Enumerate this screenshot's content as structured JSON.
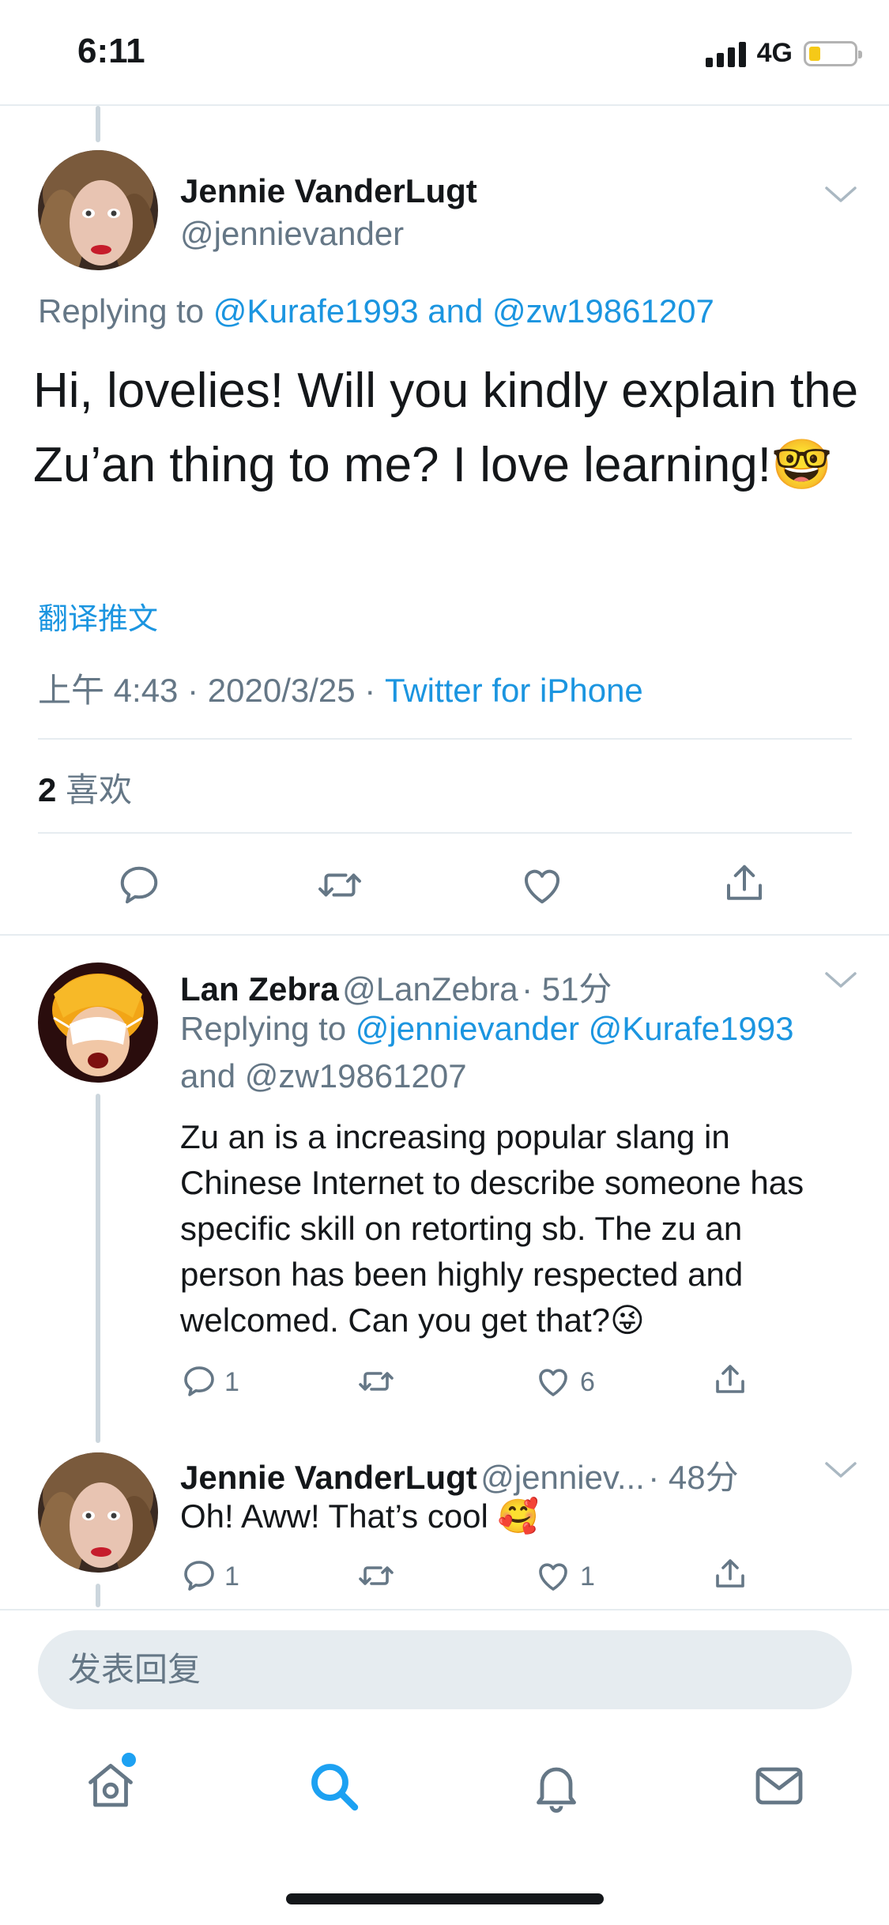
{
  "status_bar": {
    "time": "6:11",
    "network": "4G",
    "battery_level": 0.2
  },
  "main_tweet": {
    "author_name": "Jennie VanderLugt",
    "author_handle": "@jennievander",
    "replying_prefix": "Replying to",
    "replying_users": "@Kurafe1993 and @zw19861207",
    "text": "Hi, lovelies! Will you kindly explain the Zu’an thing to me? I love learning!🤓",
    "translate_label": "翻译推文",
    "time": "上午 4:43",
    "separator": "·",
    "date": "2020/3/25",
    "source": "Twitter for iPhone",
    "like_count": "2",
    "like_label": "喜欢"
  },
  "replies": [
    {
      "author_name": "Lan Zebra",
      "author_handle": "@LanZebra",
      "time": "· 51分",
      "replying_prefix": "Replying to",
      "replying_line1": "@jennievander @Kurafe1993",
      "replying_line2": "and @zw19861207",
      "text": "Zu an is a increasing popular slang in Chinese Internet to describe someone has specific skill on retorting sb.  The zu an person has been highly respected and welcomed. Can you get that?😜",
      "reply_count": "1",
      "retweet_count": "",
      "like_count": "6"
    },
    {
      "author_name": "Jennie VanderLugt",
      "author_handle": "@jenniev...",
      "time": "· 48分",
      "text": "Oh! Aww! That’s cool 🥰",
      "reply_count": "1",
      "retweet_count": "",
      "like_count": "1"
    }
  ],
  "composer": {
    "placeholder": "发表回复"
  },
  "tab_bar": {
    "items": [
      "home-icon",
      "search-icon",
      "notifications-icon",
      "messages-icon"
    ],
    "active": "search-icon",
    "home_has_badge": true
  },
  "colors": {
    "accent": "#1b95e0",
    "text": "#14171a",
    "secondary": "#657786",
    "divider": "#e6ecf0",
    "composer_bg": "#e6ecf0"
  }
}
